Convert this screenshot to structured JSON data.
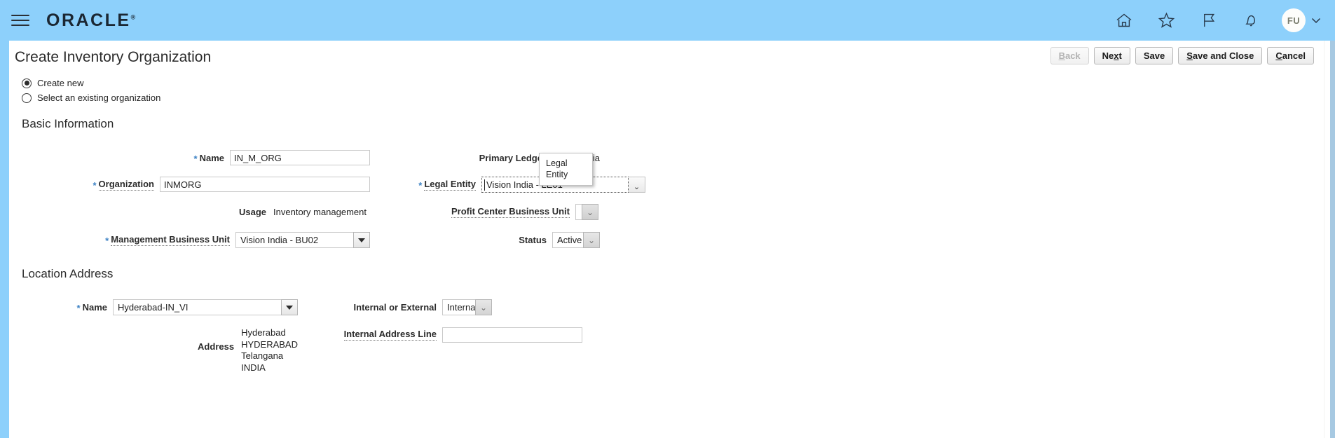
{
  "globalbar": {
    "logo": "ORACLE",
    "logo_tm": "®",
    "menu_icon": "hamburger-menu-icon",
    "icons": [
      {
        "name": "home-icon",
        "label": "Home"
      },
      {
        "name": "favorites-star-icon",
        "label": "Favorites and Recent Items"
      },
      {
        "name": "flag-icon",
        "label": "Watchlist"
      },
      {
        "name": "bell-icon",
        "label": "Notifications"
      }
    ],
    "avatar_initials": "FU",
    "avatar_chevron": "chevron-down-icon"
  },
  "page": {
    "title": "Create Inventory Organization",
    "actions": [
      {
        "label": "Back",
        "accel": "B",
        "disabled": true
      },
      {
        "label": "Next",
        "accel": "x",
        "disabled": false
      },
      {
        "label": "Save",
        "accel": "",
        "disabled": false
      },
      {
        "label": "Save and Close",
        "accel": "S",
        "disabled": false
      },
      {
        "label": "Cancel",
        "accel": "C",
        "disabled": false
      }
    ]
  },
  "mode_radios": [
    {
      "label": "Create new",
      "checked": true
    },
    {
      "label": "Select an existing organization",
      "checked": false
    }
  ],
  "basic_information": {
    "heading": "Basic Information",
    "name": {
      "label": "Name",
      "value": "IN_M_ORG",
      "required": true
    },
    "organization": {
      "label": "Organization",
      "value": "INMORG",
      "required": true
    },
    "usage": {
      "label": "Usage",
      "value": "Inventory management"
    },
    "management_business_unit": {
      "label": "Management Business Unit",
      "value": "Vision India - BU02",
      "required": true
    },
    "primary_ledger": {
      "label": "Primary Ledger",
      "value": "Vision India"
    },
    "legal_entity": {
      "label": "Legal Entity",
      "value": "Vision India - LE01",
      "required": true
    },
    "profit_center_business_unit": {
      "label": "Profit Center Business Unit",
      "value": ""
    },
    "status": {
      "label": "Status",
      "value": "Active"
    }
  },
  "tooltip": {
    "text": "Legal\nEntity"
  },
  "location_address": {
    "heading": "Location Address",
    "name": {
      "label": "Name",
      "value": "Hyderabad-IN_VI",
      "required": true
    },
    "address": {
      "label": "Address",
      "lines": [
        "Hyderabad",
        "HYDERABAD",
        "Telangana",
        "INDIA"
      ]
    },
    "internal_or_external": {
      "label": "Internal or External",
      "value": "Internal"
    },
    "internal_address_line": {
      "label": "Internal Address Line",
      "value": ""
    }
  },
  "colors": {
    "brand_bar": "#8dd0fb",
    "required_asterisk": "#3d82c4",
    "text": "#1f1f1f"
  }
}
